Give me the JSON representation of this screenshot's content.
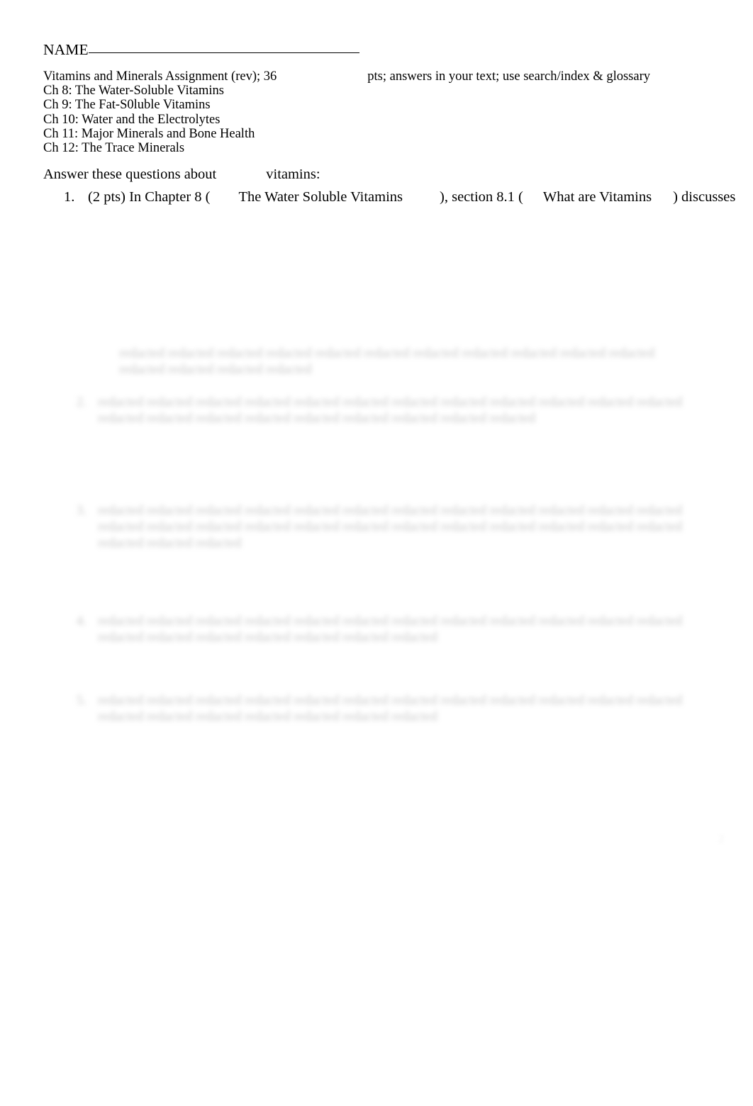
{
  "document": {
    "name_field": {
      "label": "NAME",
      "value": "",
      "rule": "________________________________________"
    },
    "header": {
      "title_part_1": "Vitamins and Minerals Assignment (rev); 36",
      "title_part_2": "pts; answers in your text; use search/index & glossary",
      "chapters": [
        "Ch 8: The Water-Soluble Vitamins",
        "Ch 9: The Fat-S0luble Vitamins",
        "Ch 10: Water and the Electrolytes",
        "Ch 11: Major Minerals and Bone Health",
        "Ch 12: The Trace Minerals"
      ]
    },
    "section_prompt": {
      "part_1": "Answer these questions about",
      "part_2": "vitamins:"
    },
    "questions": [
      {
        "number": "1.",
        "points": "(2 pts)",
        "segment_1": "In Chapter 8 (",
        "segment_2": "The Water Soluble Vitamins",
        "segment_3": "), section 8.1 (",
        "segment_4": "What are Vitamins",
        "segment_5": ") discusses"
      }
    ],
    "redacted": {
      "note": "blurred illegible body text",
      "continuation": {
        "lines": [
          "redacted redacted redacted redacted redacted redacted redacted redacted redacted redacted redacted",
          "redacted redacted redacted redacted"
        ]
      },
      "blocks": [
        {
          "number": "2.",
          "lines": [
            "redacted redacted redacted redacted redacted redacted redacted redacted redacted redacted redacted redacted",
            "redacted redacted redacted redacted redacted redacted redacted redacted redacted"
          ]
        },
        {
          "number": "3.",
          "lines": [
            "redacted redacted redacted redacted redacted redacted redacted redacted redacted redacted redacted redacted",
            "redacted redacted redacted redacted redacted redacted redacted redacted redacted redacted redacted redacted",
            "redacted redacted redacted"
          ]
        },
        {
          "number": "4.",
          "lines": [
            "redacted redacted redacted redacted redacted redacted redacted redacted redacted redacted redacted redacted",
            "redacted redacted redacted redacted redacted redacted redacted"
          ]
        },
        {
          "number": "5.",
          "lines": [
            "redacted redacted redacted redacted redacted redacted redacted redacted redacted redacted redacted redacted",
            "redacted redacted redacted redacted redacted redacted redacted"
          ]
        }
      ]
    },
    "page_mark": "2"
  }
}
